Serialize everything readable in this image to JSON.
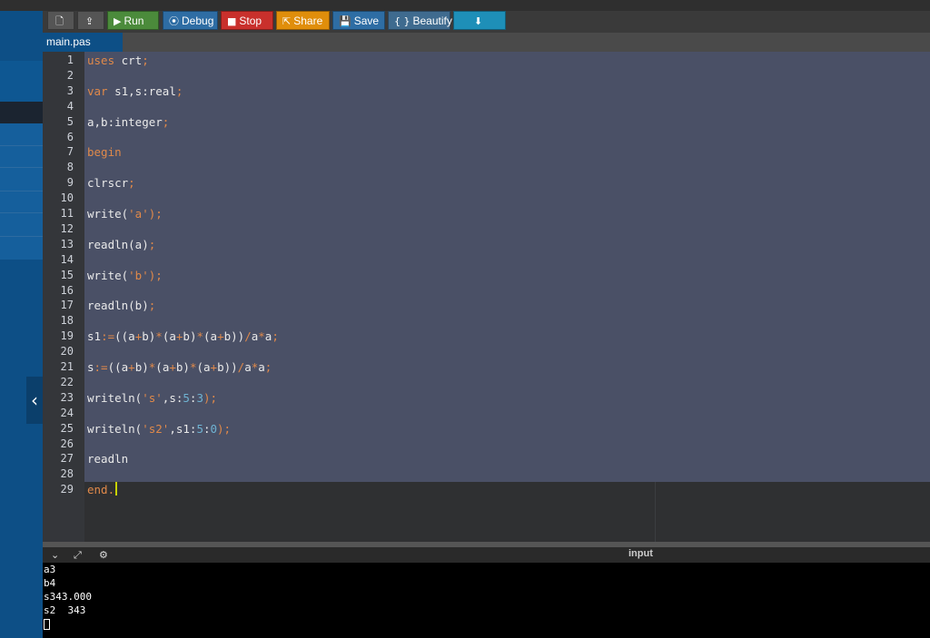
{
  "toolbar": {
    "buttons": [
      {
        "name": "file-button",
        "label": "",
        "icon": "🗋",
        "bg": "#555555"
      },
      {
        "name": "upload-button",
        "label": "",
        "icon": "⇪",
        "bg": "#555555"
      },
      {
        "name": "run-button",
        "label": "Run",
        "icon": "▶",
        "bg": "#4b8b3b"
      },
      {
        "name": "debug-button",
        "label": "Debug",
        "icon": "⦿",
        "bg": "#2e6da4"
      },
      {
        "name": "stop-button",
        "label": "Stop",
        "icon": "■",
        "bg": "#c9302c"
      },
      {
        "name": "share-button",
        "label": "Share",
        "icon": "⇱",
        "bg": "#e08e0b"
      },
      {
        "name": "save-button",
        "label": "Save",
        "icon": "💾",
        "bg": "#2e6da4"
      },
      {
        "name": "beautify-button",
        "label": "Beautify",
        "icon": "{ }",
        "bg": "#3f6b8f"
      },
      {
        "name": "download-button",
        "label": "",
        "icon": "⬇",
        "bg": "#1e8fb8"
      }
    ]
  },
  "tab": {
    "label": "main.pas"
  },
  "code": {
    "lines": [
      [
        [
          "uses ",
          "#e0894a"
        ],
        [
          "crt",
          "#eaeaea"
        ],
        [
          ";",
          "#e0894a"
        ]
      ],
      [],
      [
        [
          "var ",
          "#e0894a"
        ],
        [
          "s1,s:real",
          "#eaeaea"
        ],
        [
          ";",
          "#e0894a"
        ]
      ],
      [],
      [
        [
          "a,b:integer",
          "#eaeaea"
        ],
        [
          ";",
          "#e0894a"
        ]
      ],
      [],
      [
        [
          "begin",
          "#e0894a"
        ]
      ],
      [],
      [
        [
          "clrscr",
          "#eaeaea"
        ],
        [
          ";",
          "#e0894a"
        ]
      ],
      [],
      [
        [
          "write(",
          "#eaeaea"
        ],
        [
          "'a'",
          "#e0894a"
        ],
        [
          ");",
          "#e0894a"
        ]
      ],
      [],
      [
        [
          "readln(a)",
          "#eaeaea"
        ],
        [
          ";",
          "#e0894a"
        ]
      ],
      [],
      [
        [
          "write(",
          "#eaeaea"
        ],
        [
          "'b'",
          "#e0894a"
        ],
        [
          ");",
          "#e0894a"
        ]
      ],
      [],
      [
        [
          "readln(b)",
          "#eaeaea"
        ],
        [
          ";",
          "#e0894a"
        ]
      ],
      [],
      [
        [
          "s1",
          "#eaeaea"
        ],
        [
          ":=",
          "#e0894a"
        ],
        [
          "((a",
          "#eaeaea"
        ],
        [
          "+",
          "#e0894a"
        ],
        [
          "b)",
          "#eaeaea"
        ],
        [
          "*",
          "#e0894a"
        ],
        [
          "(a",
          "#eaeaea"
        ],
        [
          "+",
          "#e0894a"
        ],
        [
          "b)",
          "#eaeaea"
        ],
        [
          "*",
          "#e0894a"
        ],
        [
          "(a",
          "#eaeaea"
        ],
        [
          "+",
          "#e0894a"
        ],
        [
          "b))",
          "#eaeaea"
        ],
        [
          "/",
          "#e0894a"
        ],
        [
          "a",
          "#eaeaea"
        ],
        [
          "*",
          "#e0894a"
        ],
        [
          "a",
          "#eaeaea"
        ],
        [
          ";",
          "#e0894a"
        ]
      ],
      [],
      [
        [
          "s",
          "#eaeaea"
        ],
        [
          ":=",
          "#e0894a"
        ],
        [
          "((a",
          "#eaeaea"
        ],
        [
          "+",
          "#e0894a"
        ],
        [
          "b)",
          "#eaeaea"
        ],
        [
          "*",
          "#e0894a"
        ],
        [
          "(a",
          "#eaeaea"
        ],
        [
          "+",
          "#e0894a"
        ],
        [
          "b)",
          "#eaeaea"
        ],
        [
          "*",
          "#e0894a"
        ],
        [
          "(a",
          "#eaeaea"
        ],
        [
          "+",
          "#e0894a"
        ],
        [
          "b))",
          "#eaeaea"
        ],
        [
          "/",
          "#e0894a"
        ],
        [
          "a",
          "#eaeaea"
        ],
        [
          "*",
          "#e0894a"
        ],
        [
          "a",
          "#eaeaea"
        ],
        [
          ";",
          "#e0894a"
        ]
      ],
      [],
      [
        [
          "writeln(",
          "#eaeaea"
        ],
        [
          "'s'",
          "#e0894a"
        ],
        [
          ",s:",
          "#eaeaea"
        ],
        [
          "5",
          "#6fb3d2"
        ],
        [
          ":",
          "#eaeaea"
        ],
        [
          "3",
          "#6fb3d2"
        ],
        [
          ");",
          "#e0894a"
        ]
      ],
      [],
      [
        [
          "writeln(",
          "#eaeaea"
        ],
        [
          "'s2'",
          "#e0894a"
        ],
        [
          ",s1:",
          "#eaeaea"
        ],
        [
          "5",
          "#6fb3d2"
        ],
        [
          ":",
          "#eaeaea"
        ],
        [
          "0",
          "#6fb3d2"
        ],
        [
          ");",
          "#e0894a"
        ]
      ],
      [],
      [
        [
          "readln",
          "#eaeaea"
        ]
      ],
      [],
      [
        [
          "end.",
          "#e0894a"
        ]
      ]
    ]
  },
  "terminal": {
    "label": "input",
    "icons": [
      "chevron-down-icon",
      "expand-icon",
      "settings-icon"
    ],
    "lines": [
      "a3",
      "b4",
      "s343.000",
      "s2  343"
    ]
  }
}
